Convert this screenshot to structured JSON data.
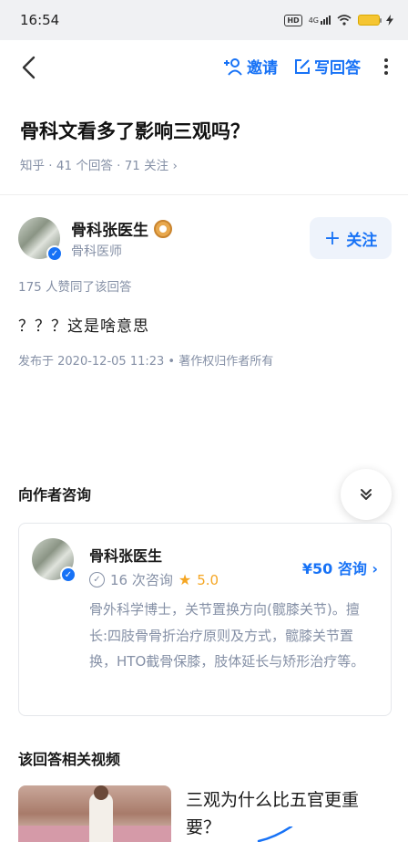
{
  "status_bar": {
    "time": "16:54",
    "network": "4G",
    "icons": [
      "hd-icon",
      "signal-icon",
      "wifi-icon",
      "battery-icon",
      "charging-icon"
    ]
  },
  "toolbar": {
    "invite_label": "邀请",
    "write_answer_label": "写回答"
  },
  "question": {
    "title": "骨科文看多了影响三观吗？",
    "meta": "知乎 · 41 个回答 · 71 关注 ›"
  },
  "author": {
    "name": "骨科张医生",
    "title": "骨科医师",
    "follow_label": "关注"
  },
  "answer": {
    "likes": "175 人赞同了该回答",
    "content": "？？？这是啥意思",
    "published": "发布于 2020-12-05 11:23 • 著作权归作者所有"
  },
  "consult": {
    "section_title": "向作者咨询",
    "card": {
      "name": "骨科张医生",
      "consult_count": "16 次咨询",
      "rating": "5.0",
      "bio": "骨外科学博士，关节置换方向(髋膝关节)。擅长:四肢骨骨折治疗原则及方式，髋膝关节置换，HTO截骨保膝，肢体延长与矫形治疗等。",
      "price_label": "¥50 咨询 ›"
    }
  },
  "videos": {
    "section_title": "该回答相关视频",
    "items": [
      {
        "title": "三观为什么比五官更重要？"
      }
    ]
  },
  "colors": {
    "accent": "#1772f6",
    "secondary_text": "#8590a6",
    "rating": "#f5a623"
  }
}
